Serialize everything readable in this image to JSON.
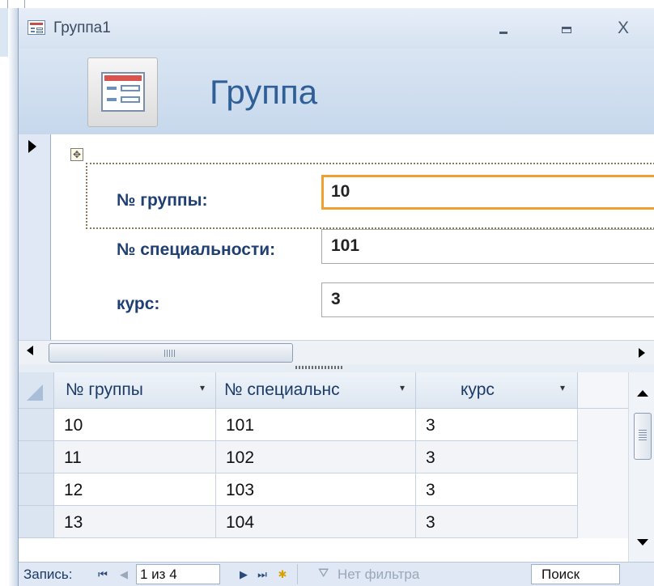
{
  "window": {
    "title": "Группа1",
    "minimize_icon": "minimize-icon",
    "maximize_icon": "maximize-icon",
    "close_label": "X"
  },
  "form": {
    "header_title": "Группа",
    "header_icon": "form-icon",
    "fields": [
      {
        "label": "№ группы:",
        "value": "10"
      },
      {
        "label": "№ специальности:",
        "value": "101"
      },
      {
        "label": "курс:",
        "value": "3"
      }
    ],
    "move_handle_glyph": "✥"
  },
  "datasheet": {
    "columns": [
      {
        "label": "№ группы",
        "dropdown": "▾"
      },
      {
        "label": "№ специальнс",
        "dropdown": "▾"
      },
      {
        "label": "курс",
        "dropdown": "▾"
      }
    ],
    "rows": [
      [
        "10",
        "101",
        "3"
      ],
      [
        "11",
        "102",
        "3"
      ],
      [
        "12",
        "103",
        "3"
      ],
      [
        "13",
        "104",
        "3"
      ]
    ]
  },
  "navigation": {
    "record_label": "Запись:",
    "first_glyph": "⏮",
    "prev_glyph": "◀",
    "position": "1 из 4",
    "next_glyph": "▶",
    "last_glyph": "⏭",
    "new_glyph": "✱",
    "filter_icon_glyph": "⛛",
    "filter_label": "Нет фильтра",
    "search_label": "Поиск"
  },
  "colors": {
    "header_title": "#2f5f96",
    "label_text": "#1f3f73",
    "active_border": "#f0a030",
    "header_bg": "#d9e5f3"
  }
}
